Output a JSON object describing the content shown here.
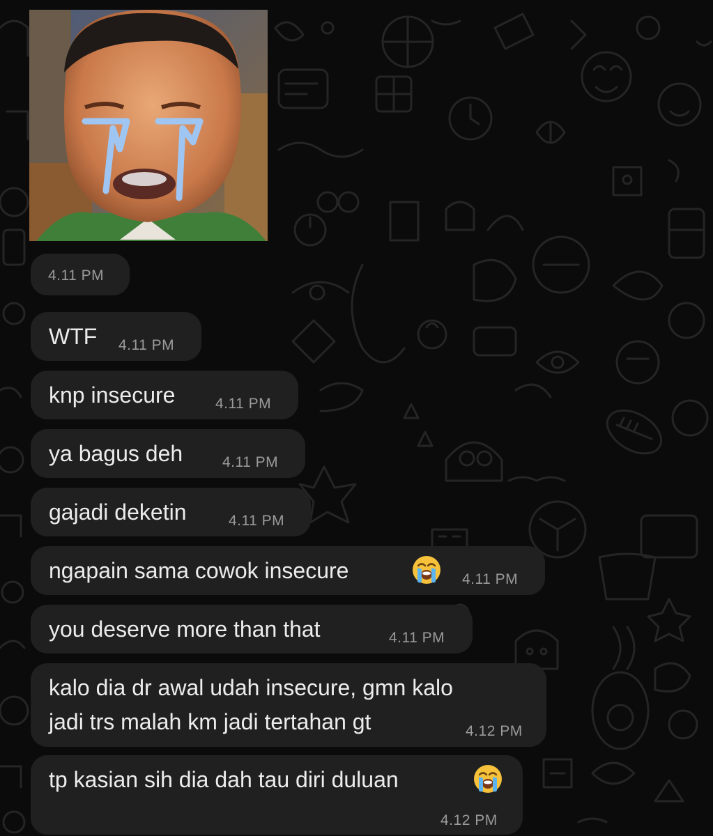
{
  "conversation": {
    "image_message": {
      "time": "4.11 PM"
    },
    "messages": [
      {
        "text": "WTF",
        "time": "4.11 PM"
      },
      {
        "text": "knp insecure",
        "time": "4.11 PM"
      },
      {
        "text": "ya bagus deh",
        "time": "4.11 PM"
      },
      {
        "text": "gajadi deketin",
        "time": "4.11 PM"
      },
      {
        "text": "ngapain sama cowok insecure",
        "emoji": "loudly-crying-face",
        "time": "4.11 PM"
      },
      {
        "text": "you deserve more than that",
        "time": "4.11 PM"
      },
      {
        "lines": [
          "kalo dia dr awal udah insecure, gmn kalo",
          "jadi trs malah km jadi tertahan gt"
        ],
        "time": "4.12 PM"
      },
      {
        "text": "tp kasian sih dia dah tau diri duluan",
        "emoji": "loudly-crying-face",
        "time": "4.12 PM"
      }
    ]
  },
  "colors": {
    "background": "#0b0b0b",
    "bubble": "#202020",
    "text": "#ececec",
    "timestamp": "#9b9b9b"
  }
}
